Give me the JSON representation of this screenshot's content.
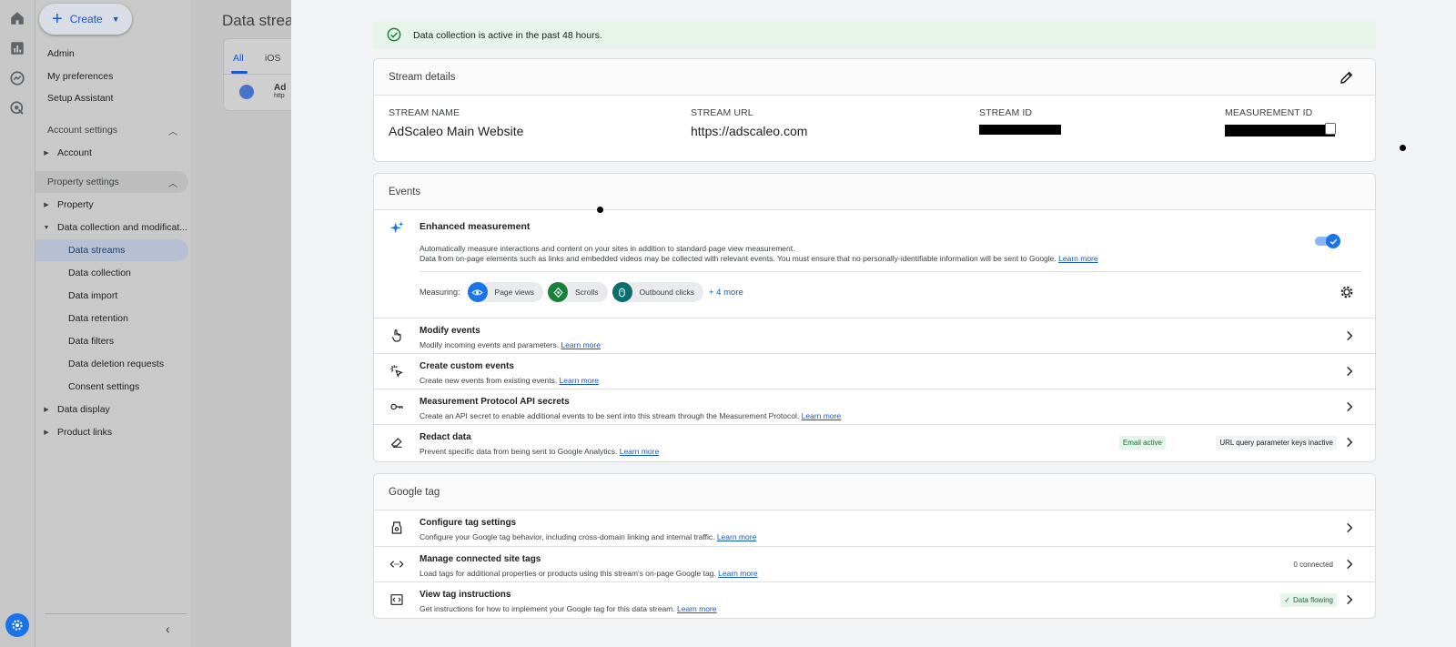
{
  "nav": {
    "create_label": "Create",
    "items": {
      "admin": "Admin",
      "my_preferences": "My preferences",
      "setup_assistant": "Setup Assistant"
    },
    "account_settings": "Account settings",
    "account": "Account",
    "property_settings": "Property settings",
    "property": "Property",
    "data_collection_mod": "Data collection and modificat...",
    "subitems": [
      "Data streams",
      "Data collection",
      "Data import",
      "Data retention",
      "Data filters",
      "Data deletion requests",
      "Consent settings"
    ],
    "data_display": "Data display",
    "product_links": "Product links"
  },
  "bg": {
    "title": "Data strea",
    "tabs": [
      "All",
      "iOS"
    ],
    "row_text": "Ad",
    "row_sub": "http"
  },
  "banner": "Data collection is active in the past 48 hours.",
  "stream_details": {
    "title": "Stream details",
    "name_label": "STREAM NAME",
    "name_value": "AdScaleo Main Website",
    "url_label": "STREAM URL",
    "url_value": "https://adscaleo.com",
    "id_label": "STREAM ID",
    "mid_label": "MEASUREMENT ID"
  },
  "events": {
    "title": "Events",
    "enhanced_title": "Enhanced measurement",
    "enhanced_desc1": "Automatically measure interactions and content on your sites in addition to standard page view measurement.",
    "enhanced_desc2": "Data from on-page elements such as links and embedded videos may be collected with relevant events. You must ensure that no personally-identifiable information will be sent to Google.",
    "learn_more": "Learn more",
    "measuring_label": "Measuring:",
    "chips": [
      "Page views",
      "Scrolls",
      "Outbound clicks"
    ],
    "more": "+ 4 more",
    "rows": [
      {
        "title": "Modify events",
        "desc": "Modify incoming events and parameters."
      },
      {
        "title": "Create custom events",
        "desc": "Create new events from existing events."
      },
      {
        "title": "Measurement Protocol API secrets",
        "desc": "Create an API secret to enable additional events to be sent into this stream through the Measurement Protocol."
      },
      {
        "title": "Redact data",
        "desc": "Prevent specific data from being sent to Google Analytics."
      }
    ],
    "badge_email": "Email active",
    "badge_url": "URL query parameter keys inactive"
  },
  "google_tag": {
    "title": "Google tag",
    "rows": [
      {
        "title": "Configure tag settings",
        "desc": "Configure your Google tag behavior, including cross-domain linking and internal traffic."
      },
      {
        "title": "Manage connected site tags",
        "desc": "Load tags for additional properties or products using this stream's on-page Google tag."
      },
      {
        "title": "View tag instructions",
        "desc": "Get instructions for how to implement your Google tag for this data stream."
      }
    ],
    "connected": "0 connected",
    "data_flowing": "Data flowing"
  },
  "colors": {
    "accent": "#1a73e8",
    "banner_bg": "#e6f4ea",
    "chip_blue": "#1a73e8",
    "chip_green": "#188038",
    "chip_teal": "#0b6e6e"
  }
}
